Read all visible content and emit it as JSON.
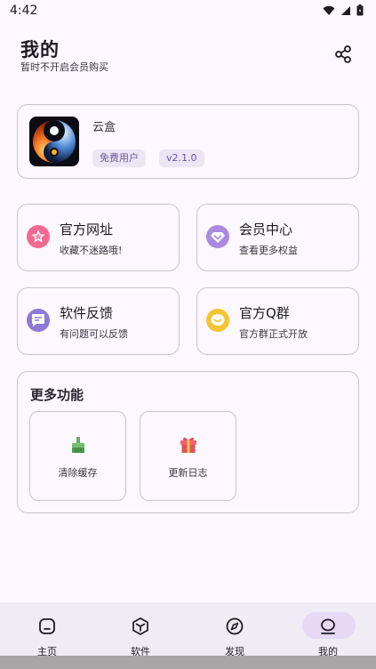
{
  "status_bar": {
    "time": "4:42"
  },
  "header": {
    "title": "我的",
    "subtitle": "暂时不开启会员购买"
  },
  "app_info": {
    "name": "云盒",
    "user_type": "免费用户",
    "version": "v2.1.0"
  },
  "tiles": [
    {
      "title": "官方网址",
      "subtitle": "收藏不迷路哦!",
      "icon": "star-icon",
      "color": "#f06a8f"
    },
    {
      "title": "会员中心",
      "subtitle": "查看更多权益",
      "icon": "diamond-icon",
      "color": "#a98ae0"
    },
    {
      "title": "软件反馈",
      "subtitle": "有问题可以反馈",
      "icon": "feedback-icon",
      "color": "#8e79d8"
    },
    {
      "title": "官方Q群",
      "subtitle": "官方群正式开放",
      "icon": "chat-icon",
      "color": "#f5c431"
    }
  ],
  "more": {
    "title": "更多功能",
    "tools": [
      {
        "label": "清除缓存",
        "icon": "broom-icon"
      },
      {
        "label": "更新日志",
        "icon": "gift-icon"
      }
    ]
  },
  "bottom_nav": {
    "items": [
      {
        "label": "主页",
        "icon": "home-icon"
      },
      {
        "label": "软件",
        "icon": "box-icon"
      },
      {
        "label": "发现",
        "icon": "compass-icon"
      },
      {
        "label": "我的",
        "icon": "profile-icon",
        "active": true
      }
    ]
  }
}
